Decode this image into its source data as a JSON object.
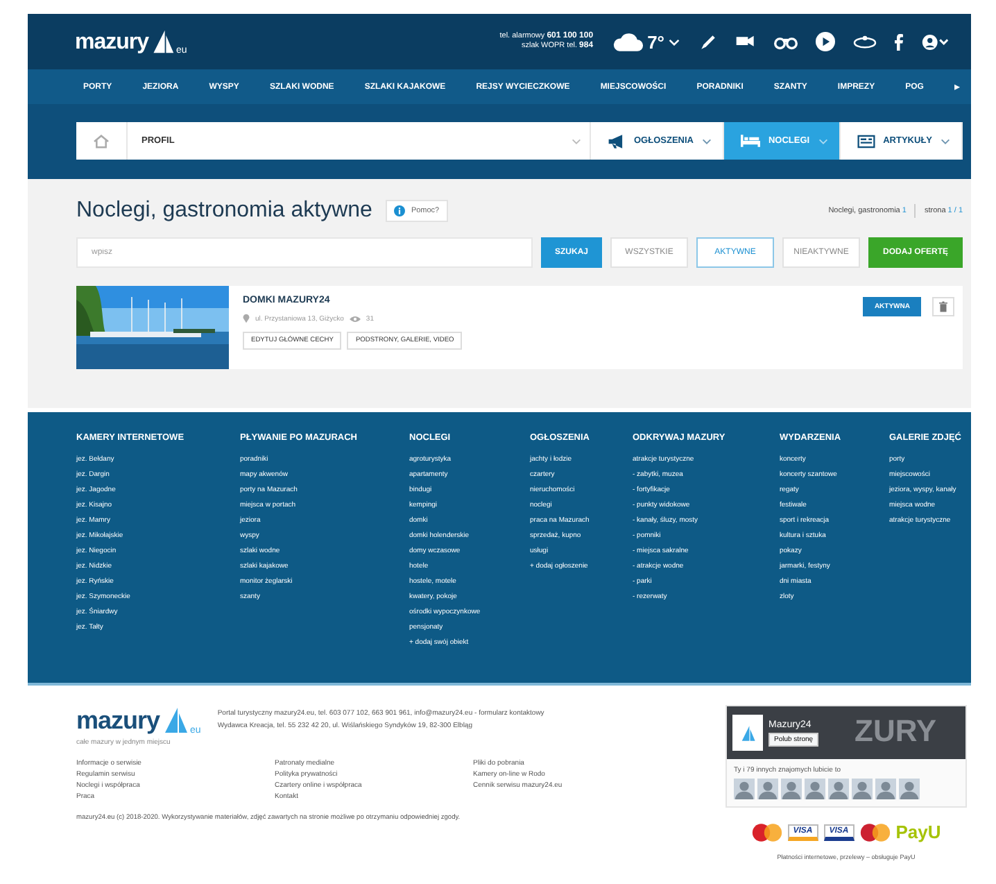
{
  "header": {
    "logo": {
      "name": "mazury",
      "suffix": "eu"
    },
    "phone_lines": [
      {
        "label": "tel. alarmowy",
        "number": "601 100 100"
      },
      {
        "label": "szlak WOPR tel.",
        "number": "984"
      }
    ],
    "weather": {
      "temperature": "7°"
    }
  },
  "nav": {
    "items": [
      "PORTY",
      "JEZIORA",
      "WYSPY",
      "SZLAKI WODNE",
      "SZLAKI KAJAKOWE",
      "REJSY WYCIECZKOWE",
      "MIEJSCOWOŚCI",
      "PORADNIKI",
      "SZANTY",
      "IMPREZY",
      "POG"
    ],
    "more": "▸"
  },
  "filter_bar": {
    "select": "PROFIL",
    "tabs": [
      {
        "label": "OGŁOSZENIA",
        "kind": "megaphone",
        "selected": false
      },
      {
        "label": "NOCLEGI",
        "kind": "bed",
        "selected": true
      },
      {
        "label": "ARTYKUŁY",
        "kind": "newspaper",
        "selected": false
      }
    ]
  },
  "content": {
    "title": "Noclegi, gastronomia aktywne",
    "help": "Pomoc?",
    "counter": {
      "label": "Noclegi, gastronomia",
      "count": "1",
      "page_label": "strona",
      "page": "1 / 1"
    },
    "search": {
      "placeholder": "wpisz",
      "button": "SZUKAJ"
    },
    "filters": [
      {
        "label": "WSZYSTKIE",
        "selected": false
      },
      {
        "label": "AKTYWNE",
        "selected": true
      },
      {
        "label": "NIEAKTYWNE",
        "selected": false
      }
    ],
    "add_button": "DODAJ OFERTĘ",
    "listings": [
      {
        "kind": "picture",
        "title": "DOMKI MAZURY24",
        "address": "ul. Przystaniowa 13, Giżycko",
        "views": "31",
        "actions": [
          "EDYTUJ GŁÓWNE CECHY",
          "PODSTRONY, GALERIE, VIDEO"
        ],
        "status": "AKTYWNA"
      }
    ]
  },
  "footer_columns": [
    {
      "heading": "KAMERY INTERNETOWE",
      "links": [
        "jez. Bełdany",
        "jez. Dargin",
        "jez. Jagodne",
        "jez. Kisajno",
        "jez. Mamry",
        "jez. Mikołajskie",
        "jez. Niegocin",
        "jez. Nidzkie",
        "jez. Ryńskie",
        "jez. Szymoneckie",
        "jez. Śniardwy",
        "jez. Tałty"
      ]
    },
    {
      "heading": "PŁYWANIE PO MAZURACH",
      "links": [
        "poradniki",
        "mapy akwenów",
        "porty na Mazurach",
        "miejsca w portach",
        "jeziora",
        "wyspy",
        "szlaki wodne",
        "szlaki kajakowe",
        "monitor żeglarski",
        "szanty"
      ]
    },
    {
      "heading": "NOCLEGI",
      "links": [
        "agroturystyka",
        "apartamenty",
        "bindugi",
        "kempingi",
        "domki",
        "domki holenderskie",
        "domy wczasowe",
        "hotele",
        "hostele, motele",
        "kwatery, pokoje",
        "ośrodki wypoczynkowe",
        "pensjonaty",
        "+ dodaj swój obiekt"
      ]
    },
    {
      "heading": "OGŁOSZENIA",
      "links": [
        "jachty i łodzie",
        "czartery",
        "nieruchomości",
        "noclegi",
        "praca na Mazurach",
        "sprzedaż, kupno",
        "usługi",
        "+ dodaj ogłoszenie"
      ]
    },
    {
      "heading": "ODKRYWAJ MAZURY",
      "links": [
        "atrakcje turystyczne",
        "- zabytki, muzea",
        "- fortyfikacje",
        "- punkty widokowe",
        "- kanały, śluzy, mosty",
        "- pomniki",
        "- miejsca sakralne",
        "- atrakcje wodne",
        "- parki",
        "- rezerwaty"
      ]
    },
    {
      "heading": "WYDARZENIA",
      "links": [
        "koncerty",
        "koncerty szantowe",
        "regaty",
        "festiwale",
        "sport i rekreacja",
        "kultura i sztuka",
        "pokazy",
        "jarmarki, festyny",
        "dni miasta",
        "zloty"
      ]
    },
    {
      "heading": "GALERIE ZDJĘĆ",
      "links": [
        "porty",
        "miejscowości",
        "jeziora, wyspy, kanały",
        "miejsca wodne",
        "atrakcje turystyczne"
      ]
    }
  ],
  "bottom": {
    "logo": {
      "name": "mazury",
      "suffix": "eu",
      "tagline": "całe mazury w jednym miejscu"
    },
    "address_lines": [
      "Portal turystyczny mazury24.eu, tel. 603 077 102, 663 901 961, info@mazury24.eu - formularz kontaktowy",
      "Wydawca Kreacja, tel. 55 232 42 20, ul. Wiślańskiego Syndyków 19, 82-300 Elbląg"
    ],
    "link_columns": [
      [
        "Informacje o serwisie",
        "Regulamin serwisu",
        "Noclegi i współpraca",
        "Praca"
      ],
      [
        "Patronaty medialne",
        "Polityka prywatności",
        "Czartery online i współpraca",
        "Kontakt"
      ],
      [
        "Pliki do pobrania",
        "Kamery on-line w Rodo",
        "Cennik serwisu mazury24.eu"
      ]
    ],
    "copyright": "mazury24.eu (c) 2018-2020. Wykorzystywanie materiałów, zdjęć zawartych na stronie możliwe po otrzymaniu odpowiedniej zgody.",
    "facebook": {
      "page": "Mazury24",
      "banner_text": "ZURY",
      "like": "Polub stronę",
      "friends": "Ty i 79 innych znajomych lubicie to"
    },
    "payments": [
      {
        "kind": "circles",
        "color": "#d9222a"
      },
      {
        "kind": "card",
        "label": "VISA",
        "color": "#f5a623"
      },
      {
        "kind": "card",
        "label": "VISA",
        "color": "#1a3c8f"
      },
      {
        "kind": "circles",
        "color": "#cc2131"
      },
      {
        "kind": "text",
        "label": "PayU",
        "color": "#a6c307"
      }
    ],
    "payments_note": "Płatności internetowe, przelewy – obsługuje PayU"
  }
}
